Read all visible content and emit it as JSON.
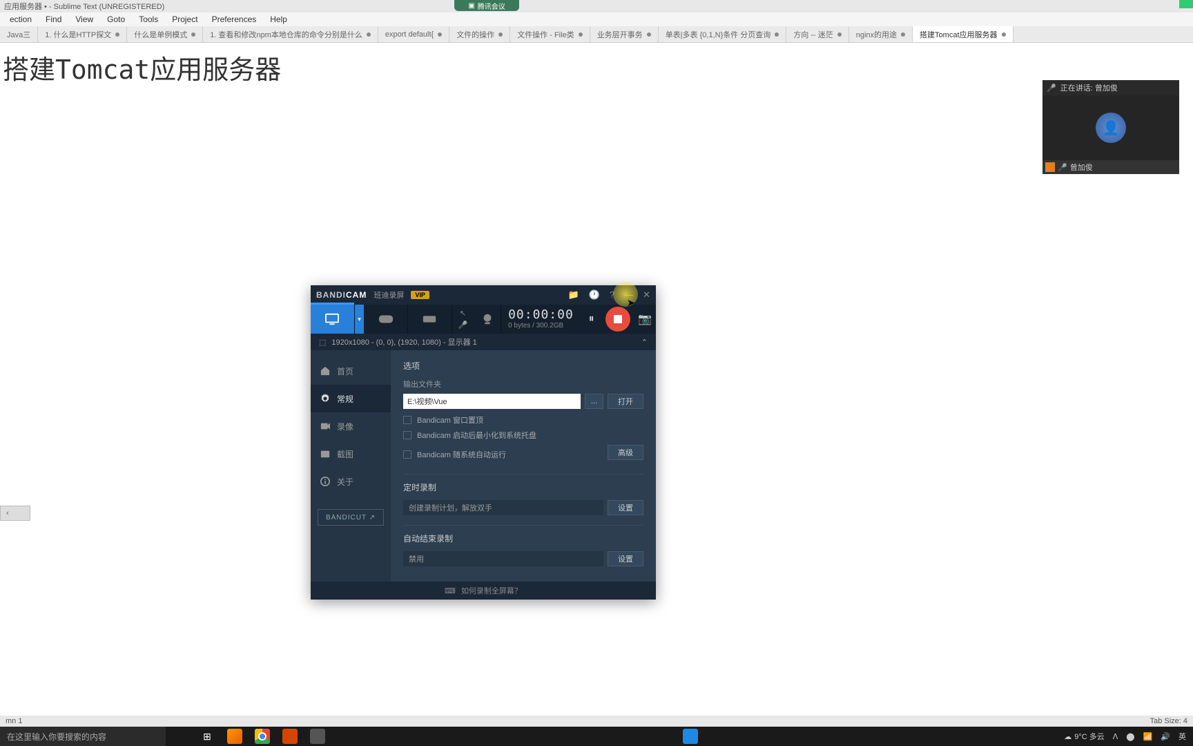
{
  "titlebar": {
    "text": "应用服务器 • - Sublime Text (UNREGISTERED)"
  },
  "menu": {
    "items": [
      "ection",
      "Find",
      "View",
      "Goto",
      "Tools",
      "Project",
      "Preferences",
      "Help"
    ]
  },
  "tabs": [
    {
      "label": "Java三",
      "mod": false
    },
    {
      "label": "1. 什么是HTTP探文",
      "mod": true
    },
    {
      "label": "什么是单例模式",
      "mod": true
    },
    {
      "label": "1. 查看和修改npm本地仓库的命令分别是什么",
      "mod": true
    },
    {
      "label": "export default{",
      "mod": true
    },
    {
      "label": "文件的操作",
      "mod": true
    },
    {
      "label": "文件操作 - File类",
      "mod": true
    },
    {
      "label": "业务层开事务",
      "mod": true
    },
    {
      "label": "单表|多表 {0,1,N}条件 分页查询",
      "mod": true
    },
    {
      "label": "方向 -- 迷茫",
      "mod": true
    },
    {
      "label": "nginx的用途",
      "mod": true
    },
    {
      "label": "搭建Tomcat应用服务器",
      "mod": true,
      "active": true
    }
  ],
  "editor": {
    "heading": "搭建Tomcat应用服务器"
  },
  "status": {
    "left": "mn 1",
    "right": "Tab Size: 4"
  },
  "taskbar": {
    "search_placeholder": "在这里输入你要搜索的内容",
    "weather": "9°C 多云",
    "ime": "英"
  },
  "meeting": {
    "pill": "腾讯会议",
    "speaking": "正在讲话: 曾加俊",
    "user": "曾加俊"
  },
  "bandicam": {
    "logo1": "BANDI",
    "logo2": "CAM",
    "sub": "班迪录屏",
    "vip": "VIP",
    "timer": "00:00:00",
    "size": "0 bytes / 300.2GB",
    "info": "1920x1080 - (0, 0), (1920, 1080) - 显示器 1",
    "side": {
      "home": "首页",
      "general": "常规",
      "record": "录像",
      "capture": "截图",
      "about": "关于",
      "cut": "BANDICUT ↗"
    },
    "main": {
      "options": "选项",
      "output_label": "输出文件夹",
      "output_value": "E:\\视频\\Vue",
      "browse": "...",
      "open": "打开",
      "chk1": "Bandicam 窗口置顶",
      "chk2": "Bandicam 启动后最小化到系统托盘",
      "chk3": "Bandicam 随系统自动运行",
      "advanced": "高级",
      "sched": "定时录制",
      "sched_desc": "创建录制计划，解放双手",
      "set": "设置",
      "autoend": "自动结束录制",
      "disabled": "禁用"
    },
    "tip": "如何录制全屏幕？"
  }
}
